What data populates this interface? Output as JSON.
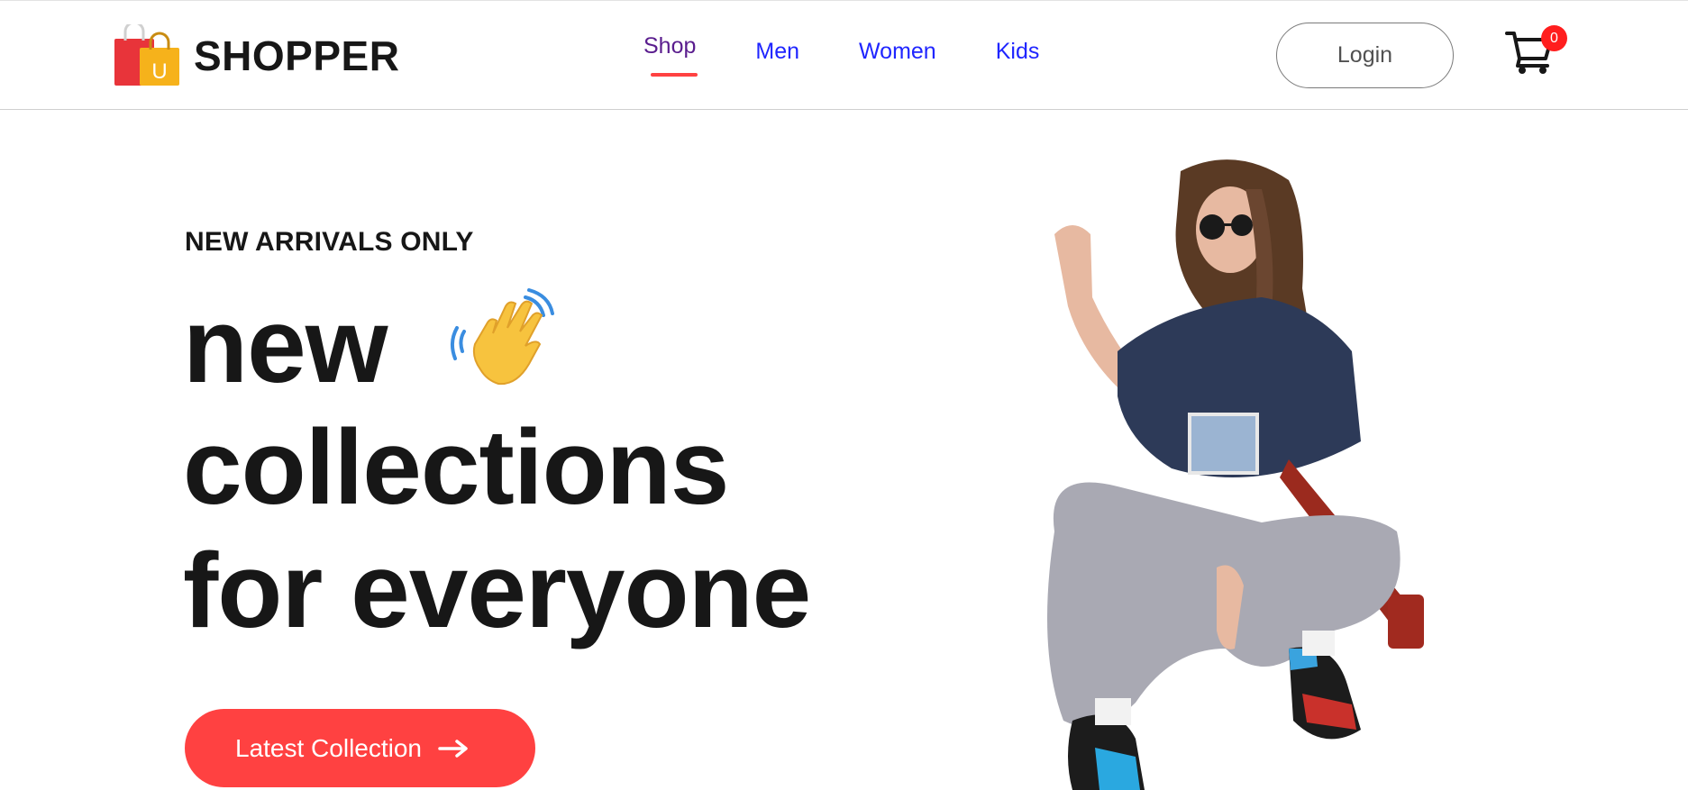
{
  "brand": {
    "name": "SHOPPER",
    "logo_letter": "U"
  },
  "nav": {
    "items": [
      {
        "label": "Shop",
        "active": true
      },
      {
        "label": "Men",
        "active": false
      },
      {
        "label": "Women",
        "active": false
      },
      {
        "label": "Kids",
        "active": false
      }
    ]
  },
  "header": {
    "login_label": "Login",
    "cart_count": "0"
  },
  "hero": {
    "eyebrow": "NEW ARRIVALS ONLY",
    "line1": "new",
    "line2": "collections",
    "line3": "for everyone",
    "cta_label": "Latest Collection",
    "wave_icon": "waving-hand-icon",
    "arrow_icon": "arrow-right-icon",
    "image_icon": "hero-model-image"
  },
  "colors": {
    "accent": "#ff4141",
    "nav_link": "#1f25ff",
    "nav_active": "#5a1d8e",
    "text": "#171717"
  }
}
